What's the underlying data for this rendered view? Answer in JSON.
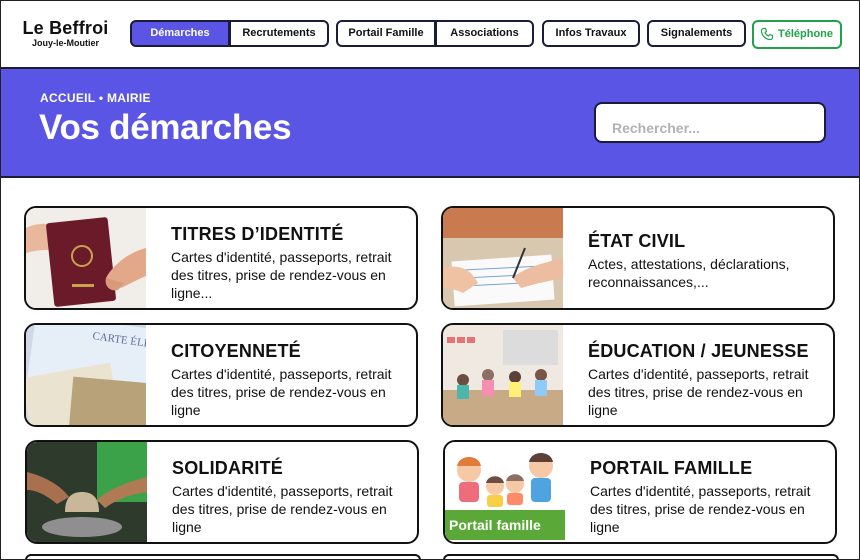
{
  "header": {
    "logo_name": "Le Beffroi",
    "logo_sub": "Jouy-le-Moutier",
    "nav": [
      "Démarches",
      "Recrutements",
      "Portail Famille",
      "Associations",
      "Infos Travaux",
      "Signalements"
    ],
    "phone_label": "Téléphone",
    "colors": {
      "accent": "#5b55e6",
      "phone": "#1fa24a",
      "border": "#1b1b3a"
    }
  },
  "hero": {
    "breadcrumb": "ACCUEIL • MAIRIE",
    "title": "Vos démarches",
    "search_placeholder": "Rechercher..."
  },
  "cards": [
    {
      "title": "TITRES D’IDENTITÉ",
      "desc": "Cartes d'identité, passeports, retrait des titres, prise de rendez-vous en ligne...",
      "image": "passport-photo"
    },
    {
      "title": "ÉTAT CIVIL",
      "desc": "Actes, attestations, déclarations, reconnaissances,...",
      "image": "writing-form-photo"
    },
    {
      "title": "CITOYENNETÉ",
      "desc": "Cartes d'identité, passeports, retrait des titres, prise de rendez-vous en ligne",
      "image": "electoral-card-photo",
      "image_text": "CARTE ÉLECTORALE"
    },
    {
      "title": "ÉDUCATION / JEUNESSE",
      "desc": "Cartes d'identité, passeports, retrait des titres, prise de rendez-vous en ligne",
      "image": "classroom-photo"
    },
    {
      "title": "SOLIDARITÉ",
      "desc": "Cartes d'identité, passeports, retrait des titres, prise de rendez-vous en ligne",
      "image": "pottery-hands-photo"
    },
    {
      "title": "PORTAIL FAMILLE",
      "desc": "Cartes d'identité, passeports, retrait des titres, prise de rendez-vous en ligne",
      "image": "family-illustration",
      "image_text": "Portail famille"
    }
  ]
}
